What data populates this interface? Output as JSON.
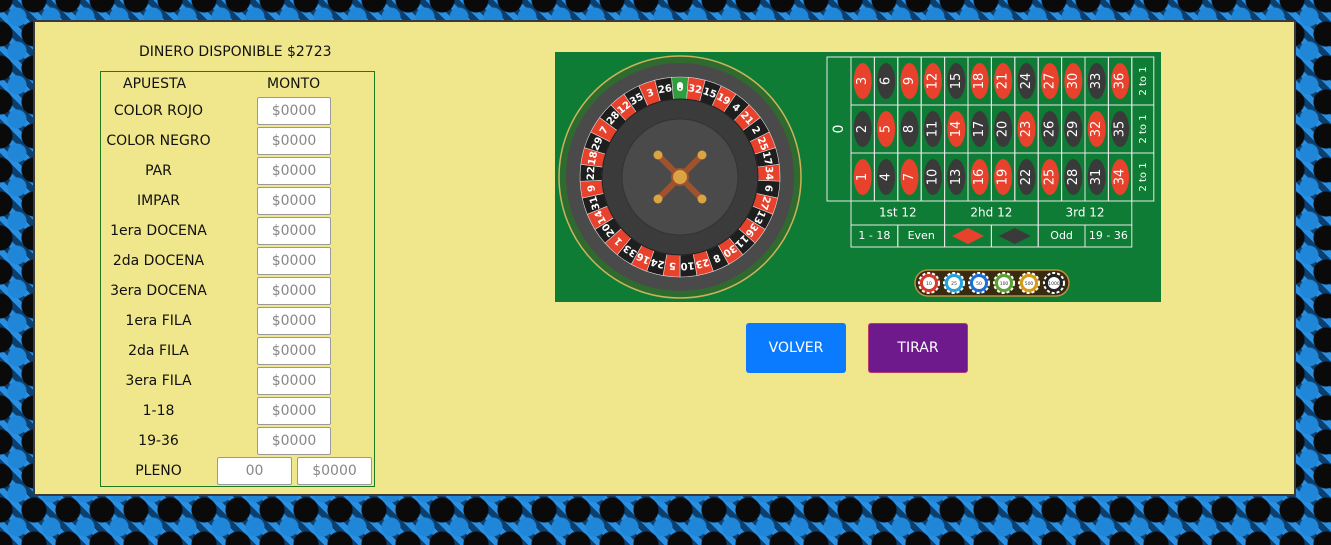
{
  "money": {
    "label": "DINERO DISPONIBLE $2723"
  },
  "bets": {
    "header_bet": "APUESTA",
    "header_amount": "MONTO",
    "amount_placeholder": "$0000",
    "pleno_number_placeholder": "00",
    "rows": [
      {
        "label": "COLOR ROJO"
      },
      {
        "label": "COLOR NEGRO"
      },
      {
        "label": "PAR"
      },
      {
        "label": "IMPAR"
      },
      {
        "label": "1era DOCENA"
      },
      {
        "label": "2da DOCENA"
      },
      {
        "label": "3era DOCENA"
      },
      {
        "label": "1era FILA"
      },
      {
        "label": "2da FILA"
      },
      {
        "label": "3era FILA"
      },
      {
        "label": "1-18"
      },
      {
        "label": "19-36"
      },
      {
        "label": "PLENO"
      }
    ]
  },
  "board": {
    "colors": {
      "felt": "#0e7c35",
      "red": "#e8412c",
      "black": "#3a3a3a",
      "green_zero": "#2f9e3c",
      "wood": "#a0522d"
    },
    "wheel_numbers": [
      "0",
      "32",
      "15",
      "19",
      "4",
      "21",
      "2",
      "25",
      "17",
      "34",
      "6",
      "27",
      "13",
      "36",
      "11",
      "30",
      "8",
      "23",
      "10",
      "5",
      "24",
      "16",
      "33",
      "1",
      "20",
      "14",
      "31",
      "9",
      "22",
      "18",
      "29",
      "7",
      "28",
      "12",
      "35",
      "3",
      "26"
    ],
    "red_numbers": [
      "1",
      "3",
      "5",
      "7",
      "9",
      "12",
      "14",
      "16",
      "18",
      "19",
      "21",
      "23",
      "25",
      "27",
      "30",
      "32",
      "34",
      "36"
    ],
    "zero": "0",
    "column_label": "2 to 1",
    "dozens": [
      "1st 12",
      "2hd  12",
      "3rd  12"
    ],
    "outside": [
      "1 - 18",
      "Even",
      "",
      "",
      "Odd",
      "19 - 36"
    ],
    "chips": [
      "10",
      "25",
      "50",
      "100",
      "500",
      "1000"
    ]
  },
  "buttons": {
    "volver": "VOLVER",
    "tirar": "TIRAR"
  }
}
